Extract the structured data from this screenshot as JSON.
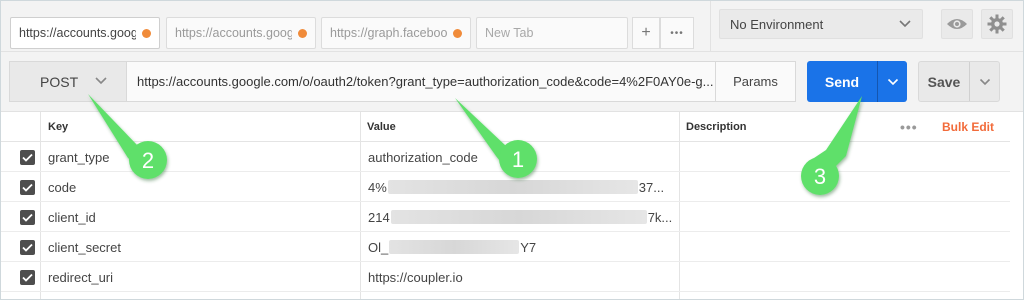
{
  "tabs": [
    {
      "title": "https://accounts.goog",
      "active": true
    },
    {
      "title": "https://accounts.goog",
      "active": false
    },
    {
      "title": "https://graph.faceboo",
      "active": false
    }
  ],
  "new_tab": "New Tab",
  "tab_actions": {
    "add": "+",
    "more": "•••"
  },
  "environment": {
    "selected": "No Environment"
  },
  "request": {
    "method": "POST",
    "url": "https://accounts.google.com/o/oauth2/token?grant_type=authorization_code&code=4%2F0AY0e-g...",
    "params_label": "Params",
    "send_label": "Send",
    "save_label": "Save"
  },
  "table": {
    "headers": {
      "key": "Key",
      "value": "Value",
      "description": "Description"
    },
    "bulk_more": "•••",
    "bulk_edit": "Bulk Edit",
    "rows": [
      {
        "key": "grant_type",
        "value_start": "authorization_code",
        "value_end": ""
      },
      {
        "key": "code",
        "value_start": "4%",
        "value_end": "37..."
      },
      {
        "key": "client_id",
        "value_start": "214",
        "value_end": "7k..."
      },
      {
        "key": "client_secret",
        "value_start": "Ol_",
        "value_end": "Y7"
      },
      {
        "key": "redirect_uri",
        "value_start": "https://coupler.io",
        "value_end": ""
      }
    ]
  },
  "callouts": [
    "1",
    "2",
    "3"
  ],
  "colors": {
    "accent": "#1a73e8",
    "callout": "#5ee06a",
    "bulk_edit": "#f26b3a",
    "tab_dot": "#f08b3a"
  }
}
